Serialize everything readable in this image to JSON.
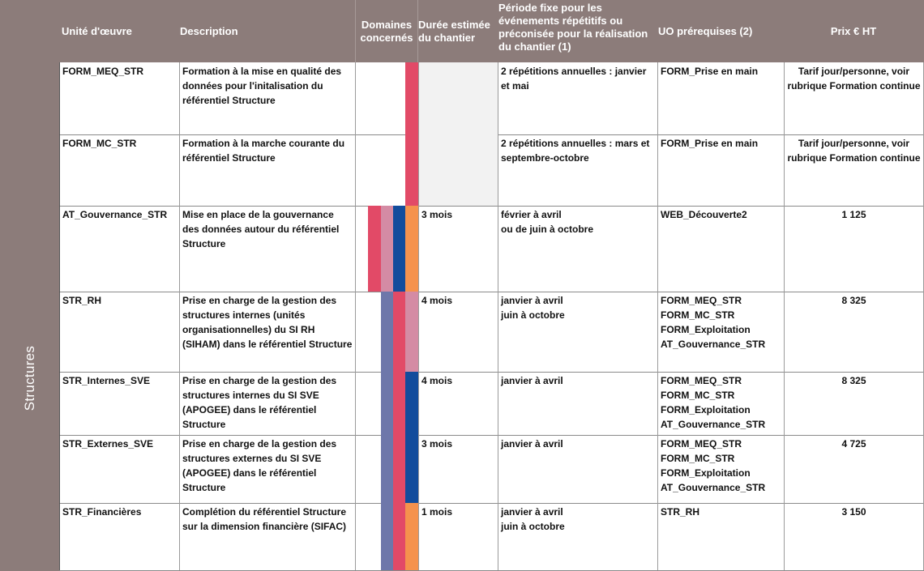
{
  "header": {
    "unit": "Unité d'œuvre",
    "description": "Description",
    "domains": "Domaines concernés",
    "duration": "Durée estimée du chantier",
    "period": "Période fixe pour les événements répétitifs ou préconisée pour la réalisation du chantier (1)",
    "prerequisites": "UO prérequises (2)",
    "price": "Prix  € HT"
  },
  "category": "Structures",
  "colors": {
    "header_bg": "#8c7c7a",
    "red": "#e24a67",
    "pink": "#d48ba4",
    "navy": "#124c9c",
    "orange": "#f5924d",
    "lavender": "#6e77aa",
    "light_grey": "#f2f2f2"
  },
  "rows": [
    {
      "unit": "FORM_MEQ_STR",
      "description": "Formation à la mise en qualité des données pour l'initalisation du référentiel Structure",
      "duration": "",
      "period": [
        "2 répétitions annuelles : janvier et mai"
      ],
      "prerequisites": [
        "FORM_Prise en main"
      ],
      "price": "Tarif jour/personne, voir rubrique Formation continue"
    },
    {
      "unit": "FORM_MC_STR",
      "description": "Formation à la marche courante du référentiel Structure",
      "duration": "",
      "period": [
        "2 répétitions annuelles : mars et septembre-octobre"
      ],
      "prerequisites": [
        "FORM_Prise en main"
      ],
      "price": "Tarif jour/personne, voir rubrique Formation continue"
    },
    {
      "unit": "AT_Gouvernance_STR",
      "description": "Mise en place de la gouvernance des données autour du référentiel Structure",
      "duration": "3 mois",
      "period": [
        "février à avril",
        "ou de juin à octobre"
      ],
      "prerequisites": [
        "WEB_Découverte2"
      ],
      "price": "1 125"
    },
    {
      "unit": "STR_RH",
      "description": "Prise en charge  de la gestion  des structures internes (unités organisationnelles) du SI RH (SIHAM) dans le référentiel Structure",
      "duration": "4 mois",
      "period": [
        "janvier à avril",
        "juin à octobre"
      ],
      "prerequisites": [
        "FORM_MEQ_STR",
        "FORM_MC_STR",
        "FORM_Exploitation",
        "AT_Gouvernance_STR"
      ],
      "price": "8 325"
    },
    {
      "unit": "STR_Internes_SVE",
      "description": "Prise en charge  de la gestion  des structures internes du SI SVE (APOGEE) dans le référentiel Structure",
      "duration": "4 mois",
      "period": [
        "janvier à avril"
      ],
      "prerequisites": [
        "FORM_MEQ_STR",
        "FORM_MC_STR",
        "FORM_Exploitation",
        "AT_Gouvernance_STR"
      ],
      "price": "8 325"
    },
    {
      "unit": "STR_Externes_SVE",
      "description": "Prise en charge  de la gestion  des structures externes du SI SVE (APOGEE) dans le référentiel Structure",
      "duration": "3 mois",
      "period": [
        "janvier à avril"
      ],
      "prerequisites": [
        "FORM_MEQ_STR",
        "FORM_MC_STR",
        "FORM_Exploitation",
        "AT_Gouvernance_STR"
      ],
      "price": "4 725"
    },
    {
      "unit": "STR_Financières",
      "description": "Complétion du référentiel Structure sur la dimension financière (SIFAC)",
      "duration": "1 mois",
      "period": [
        "janvier à avril",
        "juin à octobre"
      ],
      "prerequisites": [
        "STR_RH"
      ],
      "price": "3 150"
    }
  ]
}
